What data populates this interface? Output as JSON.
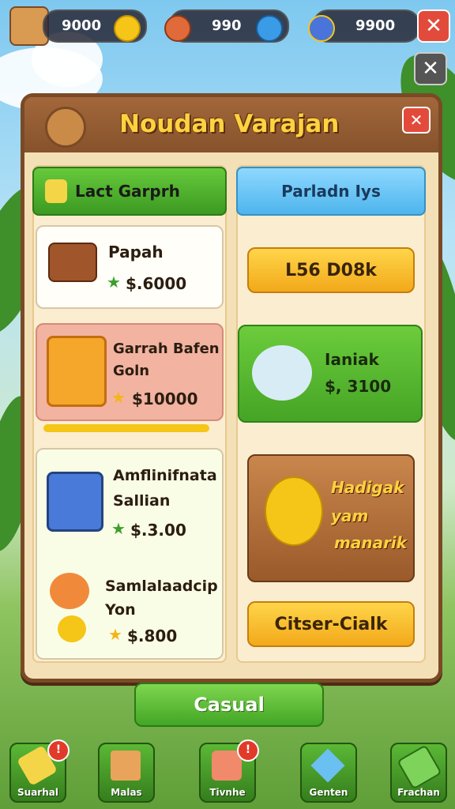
{
  "hud": {
    "coins": "9000",
    "gems": "990",
    "energy": "9900",
    "close_label": "✕",
    "close2_label": "✕"
  },
  "panel": {
    "title": "Noudan Varajan",
    "close_label": "✕"
  },
  "tabs": {
    "left": "Lact Garprh",
    "right": "Parladn Iys"
  },
  "cards": {
    "c1": {
      "name": "Papah",
      "price": "$.6000"
    },
    "right_btn": "L56 D08k",
    "c2": {
      "name_line1": "Garrah Bafen",
      "name_line2": "Goln",
      "price": "$10000"
    },
    "c3": {
      "name": "Ianiak",
      "price": "$, 3100"
    },
    "c4": {
      "name_line1": "Amflinifnata",
      "name_line2": "Sallian",
      "price": "$.3.00"
    },
    "c5": {
      "name_line1": "Samlalaadcip",
      "name_line2": "Yon",
      "price": "$.800"
    },
    "featured": {
      "line1": "Hadigak",
      "line2": "yam",
      "line3": "manarik"
    },
    "featured_btn": "Citser-Cialk"
  },
  "casual_label": "Casual",
  "nav": [
    {
      "label": "Suarhal",
      "badge": "!"
    },
    {
      "label": "Malas",
      "badge": ""
    },
    {
      "label": "Tivnhe",
      "badge": "!"
    },
    {
      "label": "Genten",
      "badge": ""
    },
    {
      "label": "Frachan",
      "badge": ""
    }
  ],
  "colors": {
    "board_frame": "#7a4a26",
    "title": "#ffd23f",
    "accent_green": "#45a425",
    "accent_yellow": "#f2a91a",
    "close_red": "#e24b3b"
  }
}
